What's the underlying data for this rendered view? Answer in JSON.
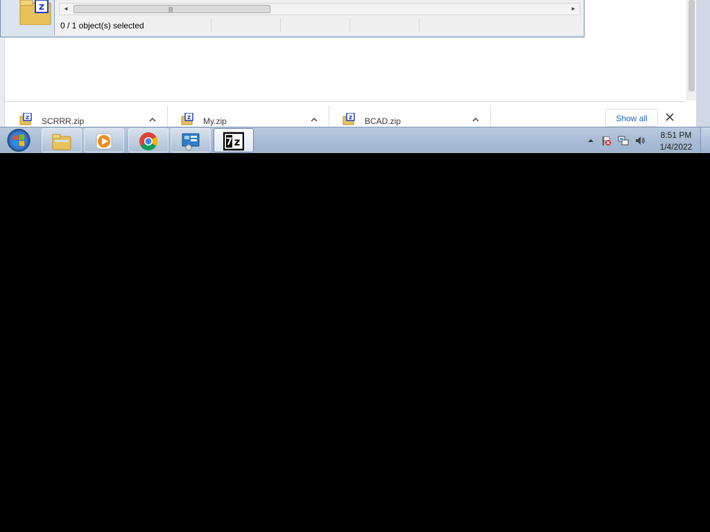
{
  "zip_window": {
    "status_text": "0 / 1 object(s) selected",
    "folder_icon_letter": "Z"
  },
  "download_shelf": {
    "items": [
      {
        "name": "SCRRR.zip"
      },
      {
        "name": "My.zip"
      },
      {
        "name": "BCAD.zip"
      }
    ],
    "show_all_label": "Show all"
  },
  "taskbar": {
    "apps": [
      {
        "icon": "windows-explorer-icon"
      },
      {
        "icon": "media-player-icon"
      },
      {
        "icon": "chrome-icon"
      },
      {
        "icon": "control-panel-icon"
      },
      {
        "icon": "seven-zip-icon",
        "label": "7z"
      }
    ],
    "clock": {
      "time": "8:51 PM",
      "date": "1/4/2022"
    }
  },
  "colors": {
    "accent_link": "#1a66c2",
    "taskbar": "#a8bcd4",
    "background": "#000000"
  }
}
